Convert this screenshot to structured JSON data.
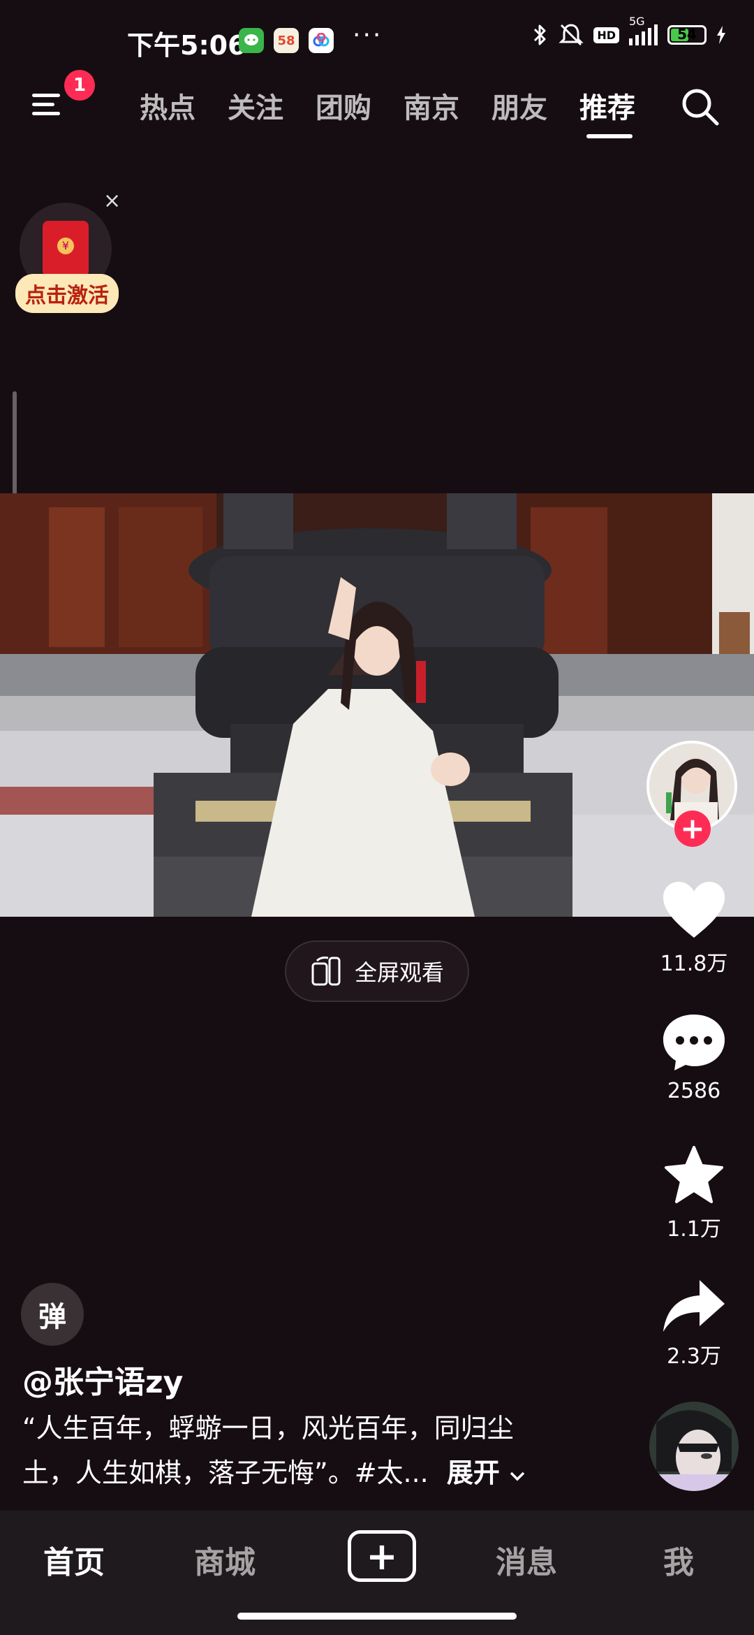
{
  "status_bar": {
    "time": "下午5:06",
    "app_badge_58": "58",
    "more": "···",
    "network": "5G",
    "hd": "HD",
    "battery_level": "54",
    "battery_fraction": 0.54
  },
  "top_nav": {
    "menu_badge": "1",
    "tabs": [
      {
        "label": "热点"
      },
      {
        "label": "关注"
      },
      {
        "label": "团购"
      },
      {
        "label": "南京"
      },
      {
        "label": "朋友"
      },
      {
        "label": "推荐"
      }
    ],
    "active_tab": "推荐"
  },
  "red_packet": {
    "label": "点击激活",
    "close": "×",
    "coin": "¥"
  },
  "video": {
    "fullscreen_label": "全屏观看"
  },
  "actions": {
    "follow": "+",
    "likes": "11.8万",
    "comments": "2586",
    "favorites": "1.1万",
    "shares": "2.3万"
  },
  "post": {
    "danmu": "弹",
    "author": "@张宁语zy",
    "description_line1": "“人生百年，蜉蝣一日，风光百年，同归尘",
    "description_line2": "土，人生如棋，落子无悔”。#太...",
    "expand": "展开"
  },
  "bottom_nav": {
    "home": "首页",
    "mall": "商城",
    "create": "+",
    "messages": "消息",
    "me": "我"
  },
  "colors": {
    "background": "#160d12",
    "accent": "#fe2c55",
    "battery": "#48c94a"
  }
}
